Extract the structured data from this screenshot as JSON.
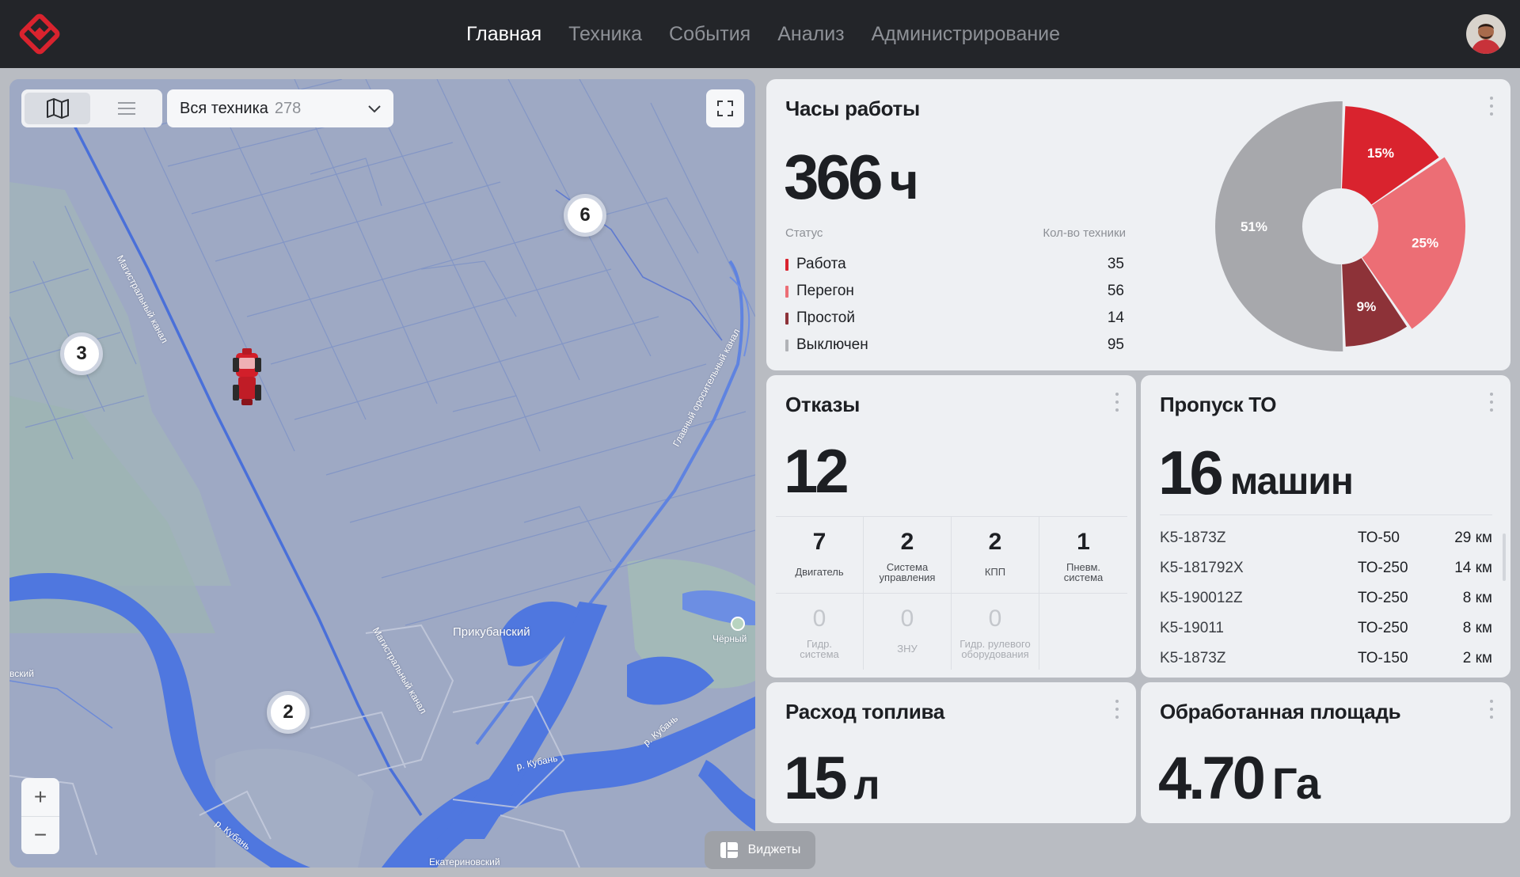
{
  "nav": {
    "items": [
      "Главная",
      "Техника",
      "События",
      "Анализ",
      "Администрирование"
    ],
    "active_index": 0
  },
  "map": {
    "filter_label": "Вся техника",
    "filter_count": "278",
    "clusters": [
      "6",
      "3",
      "2"
    ],
    "labels": {
      "prikubansky": "Прикубанский",
      "chernyi": "Чёрный",
      "vsky": "вский",
      "ekaterinovsky": "Екатериновский",
      "kuban1": "р. Кубань",
      "kuban2": "р. Кубань",
      "kuban3": "р. Кубань",
      "magistral_canal": "Магистральный канал",
      "glavny_canal": "Главный оросительный канал",
      "canal_small": "Магистральный канал"
    },
    "zoom_in": "+",
    "zoom_out": "−",
    "widgets_label": "Виджеты"
  },
  "hours": {
    "title": "Часы работы",
    "value": "366",
    "unit": "ч",
    "col_status": "Статус",
    "col_count": "Кол-во техники",
    "rows": [
      {
        "label": "Работа",
        "value": "35",
        "color": "#d9232e"
      },
      {
        "label": "Перегон",
        "value": "56",
        "color": "#ec6e75"
      },
      {
        "label": "Простой",
        "value": "14",
        "color": "#8d3238"
      },
      {
        "label": "Выключен",
        "value": "95",
        "color": "#b1b3b7"
      }
    ],
    "chart_data": {
      "type": "pie",
      "categories": [
        "Работа",
        "Перегон",
        "Простой",
        "Выключен"
      ],
      "values": [
        15,
        25,
        9,
        51
      ],
      "labels": [
        "15%",
        "25%",
        "9%",
        "51%"
      ],
      "colors": [
        "#d9232e",
        "#ec6e75",
        "#8d3238",
        "#a7a8ac"
      ]
    }
  },
  "failures": {
    "title": "Отказы",
    "value": "12",
    "cells": [
      {
        "n": "7",
        "label": "Двигатель"
      },
      {
        "n": "2",
        "label": "Система управления"
      },
      {
        "n": "2",
        "label": "КПП"
      },
      {
        "n": "1",
        "label": "Пневм. система"
      },
      {
        "n": "0",
        "label": "Гидр. система"
      },
      {
        "n": "0",
        "label": "ЗНУ"
      },
      {
        "n": "0",
        "label": "Гидр. рулевого оборудования"
      }
    ]
  },
  "to_skip": {
    "title": "Пропуск ТО",
    "value": "16",
    "unit": "машин",
    "rows": [
      {
        "id": "K5-1873Z",
        "to": "ТО-50",
        "km": "29 км"
      },
      {
        "id": "K5-181792X",
        "to": "ТО-250",
        "km": "14 км"
      },
      {
        "id": "K5-190012Z",
        "to": "ТО-250",
        "km": "8 км"
      },
      {
        "id": "K5-19011",
        "to": "ТО-250",
        "km": "8 км"
      },
      {
        "id": "K5-1873Z",
        "to": "ТО-150",
        "km": "2 км"
      }
    ]
  },
  "fuel": {
    "title": "Расход топлива",
    "value": "15",
    "unit": "л"
  },
  "area": {
    "title": "Обработанная площадь",
    "value": "4.70",
    "unit": "Га"
  }
}
